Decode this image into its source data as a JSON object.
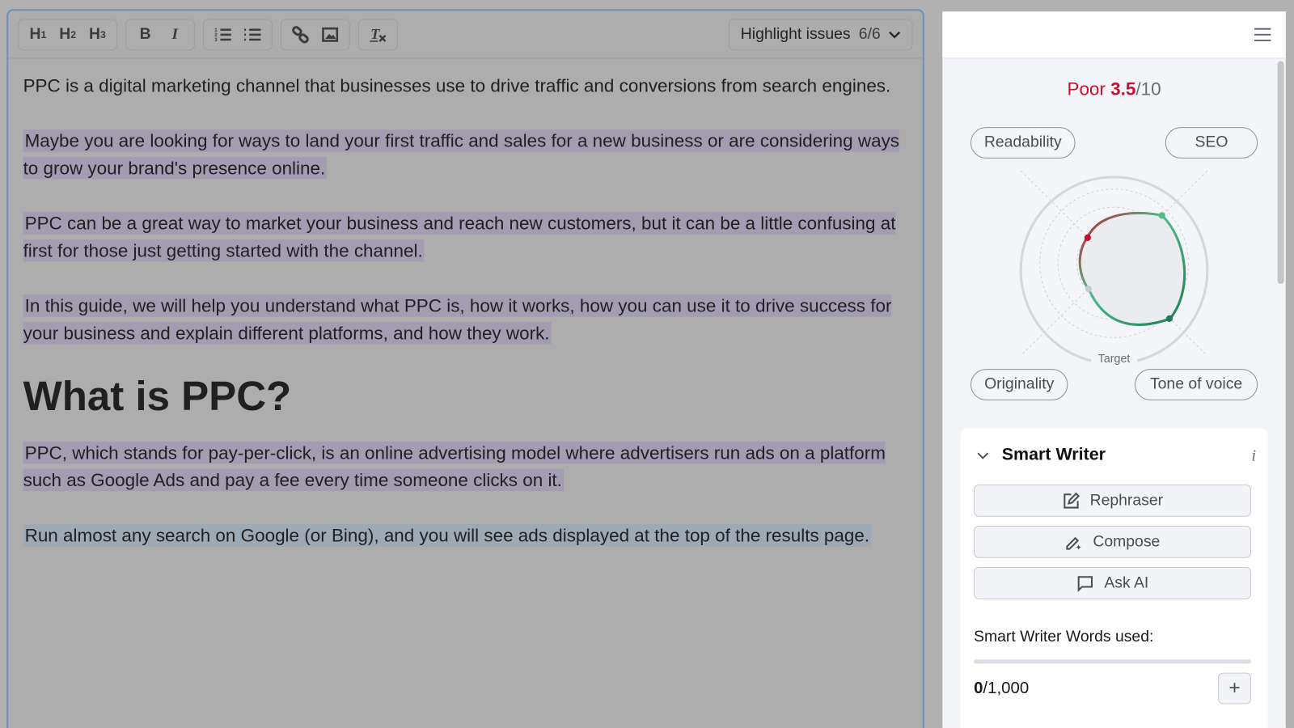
{
  "toolbar": {
    "h1": "H",
    "h2": "H",
    "h3": "H",
    "h1_sub": "1",
    "h2_sub": "2",
    "h3_sub": "3",
    "bold": "B",
    "italic": "I",
    "highlight_label": "Highlight issues",
    "highlight_count": "6/6"
  },
  "content": {
    "p1": "PPC is a digital marketing channel that businesses use to drive traffic and conversions from search engines.",
    "p2": "Maybe you are looking for ways to land your first traffic and sales for a new business or are considering ways to grow your brand's presence online.",
    "p3": "PPC can be a great way to market your business and reach new customers, but it can be a little confusing at first for those just getting started with the channel.",
    "p4": "In this guide, we will help you understand what PPC is, how it works, how you can use it to drive success for your business and explain different platforms, and how they work.",
    "h2": "What is PPC?",
    "p5": "PPC, which stands for pay-per-click, is an online advertising model where advertisers run ads on a platform such as Google Ads and pay a fee every time someone clicks on it.",
    "p6": "Run almost any search on Google (or Bing), and you will see ads displayed at the top of the results page."
  },
  "panel": {
    "rating": "Poor",
    "score": "3.5",
    "max": "/10",
    "score_color": "#c8102e",
    "axes": [
      "Readability",
      "SEO",
      "Originality",
      "Tone of voice"
    ],
    "target_label": "Target",
    "smart_writer": {
      "title": "Smart Writer",
      "buttons": [
        "Rephraser",
        "Compose",
        "Ask AI"
      ],
      "words_label": "Smart Writer Words used:",
      "used": "0",
      "limit": "/1,000",
      "used_fraction": 0
    }
  }
}
